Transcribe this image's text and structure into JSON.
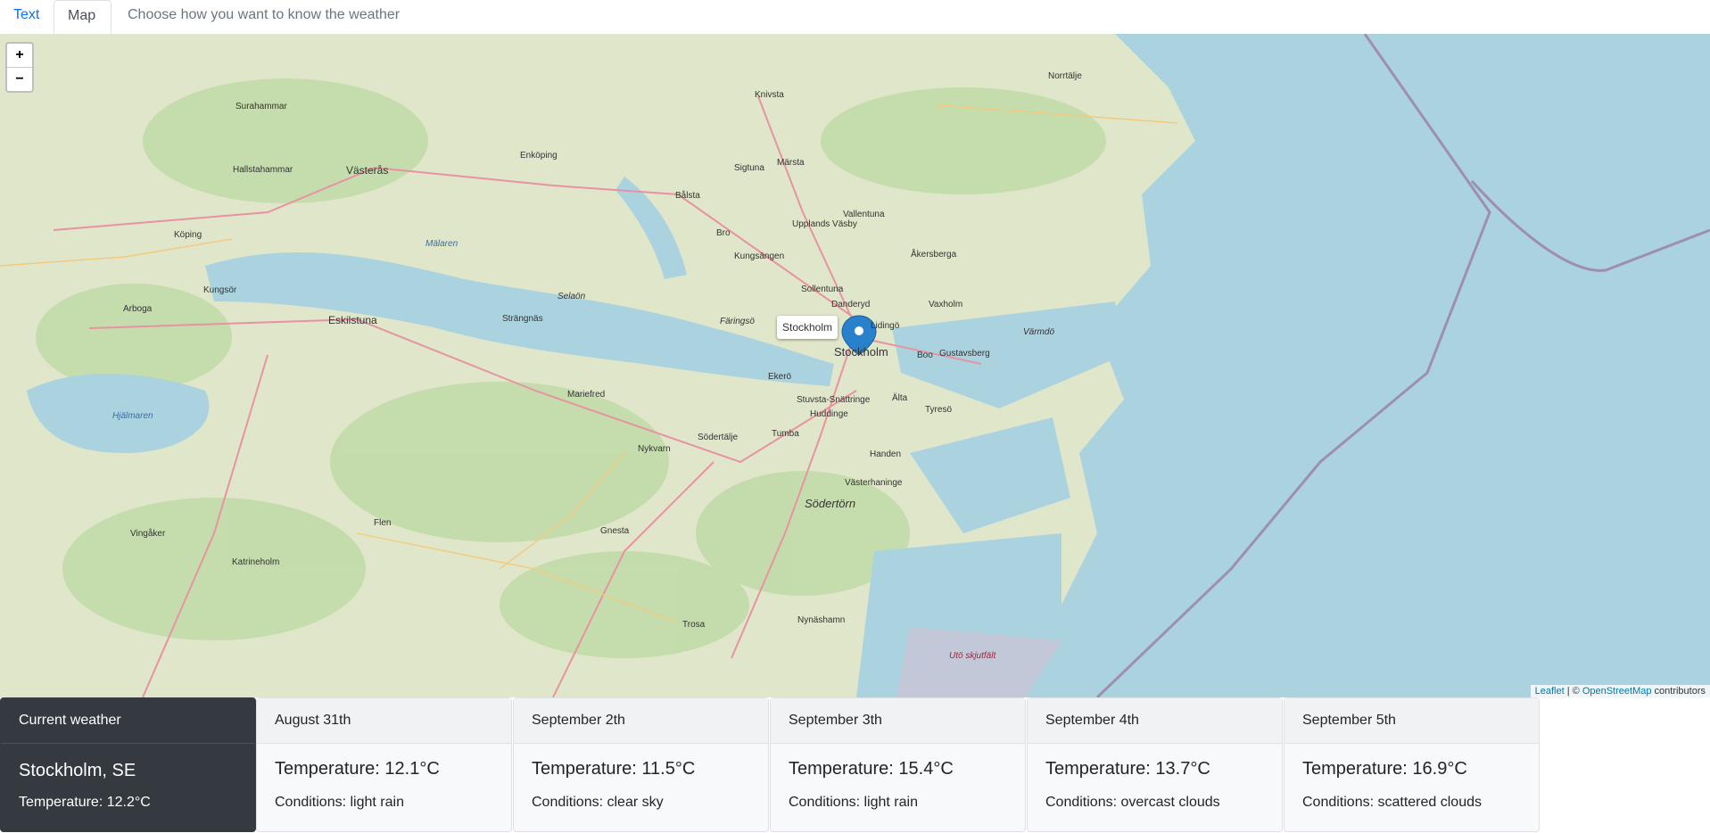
{
  "nav": {
    "tab_text": "Text",
    "tab_map": "Map",
    "hint": "Choose how you want to know the weather"
  },
  "map": {
    "zoom_in": "+",
    "zoom_out": "−",
    "popup": "Stockholm",
    "attribution_leaflet": "Leaflet",
    "attribution_sep": " | © ",
    "attribution_osm": "OpenStreetMap",
    "attribution_tail": " contributors",
    "labels": {
      "norrtalje": "Norrtälje",
      "knivsta": "Knivsta",
      "surahammar": "Surahammar",
      "hallstahammar": "Hallstahammar",
      "vasteras": "Västerås",
      "enkoping": "Enköping",
      "sigtuna": "Sigtuna",
      "marsta": "Märsta",
      "balsta": "Bålsta",
      "upplands_vasby": "Upplands Väsby",
      "vallentuna": "Vallentuna",
      "koping": "Köping",
      "malaren": "Mälaren",
      "bro": "Bro",
      "kungsangen": "Kungsängen",
      "akersberga": "Åkersberga",
      "kungsor": "Kungsör",
      "arboga": "Arboga",
      "selaon": "Selaön",
      "sollentuna": "Sollentuna",
      "danderyd": "Danderyd",
      "vaxholm": "Vaxholm",
      "eskilstuna": "Eskilstuna",
      "strangnas": "Strängnäs",
      "faringso": "Färingsö",
      "lidingo": "Lidingö",
      "varmdo": "Värmdö",
      "stockholm": "Stockholm",
      "boo": "Boo",
      "gustavsberg": "Gustavsberg",
      "ekero": "Ekerö",
      "hjalmaren": "Hjälmaren",
      "mariefred": "Mariefred",
      "stuvsta": "Stuvsta-Snättringe",
      "alta": "Älta",
      "tyreso": "Tyresö",
      "huddinge": "Huddinge",
      "nykvarn": "Nykvarn",
      "sodertalje": "Södertälje",
      "tumba": "Tumba",
      "handen": "Handen",
      "vasterhaninge": "Västerhaninge",
      "sodertorn": "Södertörn",
      "vingaker": "Vingåker",
      "flen": "Flen",
      "gnesta": "Gnesta",
      "katrineholm": "Katrineholm",
      "trosa": "Trosa",
      "nynashamn": "Nynäshamn",
      "uto": "Utö skjutfält"
    }
  },
  "current": {
    "header": "Current weather",
    "city": "Stockholm, SE",
    "temperature": "Temperature: 12.2°C"
  },
  "forecast": [
    {
      "date": "August 31th",
      "temperature": "Temperature: 12.1°C",
      "conditions": "Conditions: light rain"
    },
    {
      "date": "September 2th",
      "temperature": "Temperature: 11.5°C",
      "conditions": "Conditions: clear sky"
    },
    {
      "date": "September 3th",
      "temperature": "Temperature: 15.4°C",
      "conditions": "Conditions: light rain"
    },
    {
      "date": "September 4th",
      "temperature": "Temperature: 13.7°C",
      "conditions": "Conditions: overcast clouds"
    },
    {
      "date": "September 5th",
      "temperature": "Temperature: 16.9°C",
      "conditions": "Conditions: scattered clouds"
    }
  ],
  "colors": {
    "sea": "#aad3df",
    "land": "#dfe6c9",
    "forest": "#add19e",
    "road_major": "#e892a2",
    "marker": "#2a81cb"
  }
}
